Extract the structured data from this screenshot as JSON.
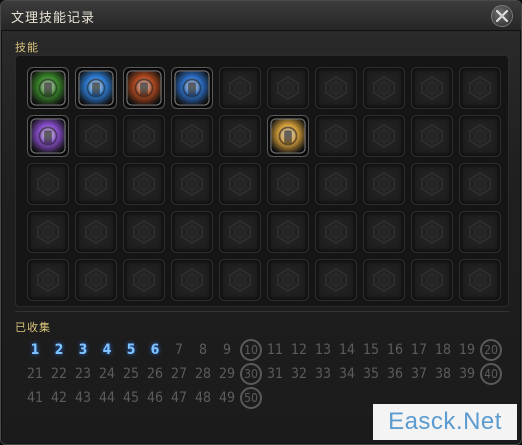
{
  "window": {
    "title": "文理技能记录"
  },
  "skills": {
    "label": "技能",
    "slots": [
      {
        "icon": "green-gear-skill-icon",
        "color": "#3a8a2a"
      },
      {
        "icon": "blue-swirl-skill-icon",
        "color": "#2d7fd8"
      },
      {
        "icon": "red-lantern-skill-icon",
        "color": "#b34a1e"
      },
      {
        "icon": "blue-figure-skill-icon",
        "color": "#2c6fc9"
      },
      null,
      null,
      null,
      null,
      null,
      null,
      {
        "icon": "purple-hammer-skill-icon",
        "color": "#8a4fd0"
      },
      null,
      null,
      null,
      null,
      {
        "icon": "gold-medallion-skill-icon",
        "color": "#d7a03a"
      },
      null,
      null,
      null,
      null,
      null,
      null,
      null,
      null,
      null,
      null,
      null,
      null,
      null,
      null,
      null,
      null,
      null,
      null,
      null,
      null,
      null,
      null,
      null,
      null,
      null,
      null,
      null,
      null,
      null,
      null,
      null,
      null,
      null,
      null
    ]
  },
  "collected": {
    "label": "已收集",
    "rows": [
      [
        "1",
        "2",
        "3",
        "4",
        "5",
        "6",
        "7",
        "8",
        "9",
        "10",
        "11",
        "12",
        "13",
        "14",
        "15",
        "16",
        "17",
        "18",
        "19",
        "20"
      ],
      [
        "21",
        "22",
        "23",
        "24",
        "25",
        "26",
        "27",
        "28",
        "29",
        "30",
        "31",
        "32",
        "33",
        "34",
        "35",
        "36",
        "37",
        "38",
        "39",
        "40"
      ],
      [
        "41",
        "42",
        "43",
        "44",
        "45",
        "46",
        "47",
        "48",
        "49",
        "50"
      ]
    ],
    "obtained": [
      "1",
      "2",
      "3",
      "4",
      "5",
      "6"
    ],
    "milestones": [
      "10",
      "20",
      "30",
      "40",
      "50"
    ]
  },
  "watermark": {
    "text": "Easck.Net"
  }
}
